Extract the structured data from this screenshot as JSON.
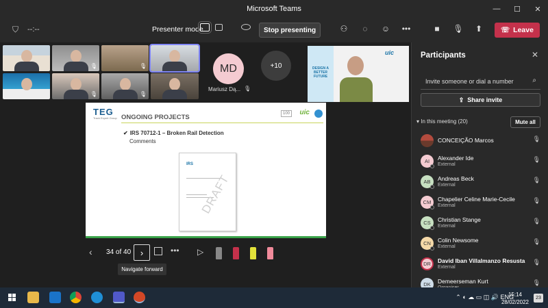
{
  "window": {
    "title": "Microsoft Teams",
    "controls": [
      "—",
      "☐",
      "✕"
    ]
  },
  "toolbar": {
    "timer": "--:--",
    "presenter_mode": "Presenter mode",
    "stop_presenting": "Stop presenting",
    "leave": "Leave"
  },
  "stage": {
    "md_initials": "MD",
    "md_name": "Mariusz Dą...",
    "more_count": "+10"
  },
  "slide": {
    "teg_logo": "TEG",
    "teg_sub": "Track Expert Group",
    "heading": "ONGOING PROJECTS",
    "logo_100": "100",
    "logo_uic": "uic",
    "bullet": "IRS 70712-1 – Broken Rail Detection",
    "sub": "Comments",
    "doc_irs": "IRS",
    "doc_draft": "DRAFT"
  },
  "speaker_banner": "DESIGN A BETTER FUTURE",
  "speaker_logo": "uic",
  "navigation": {
    "counter": "34 of 40",
    "tooltip": "Navigate forward"
  },
  "panel": {
    "title": "Participants",
    "invite_placeholder": "Invite someone or dial a number",
    "share_invite": "Share invite",
    "in_meeting": "In this meeting (20)",
    "mute_all": "Mute all",
    "participants": [
      {
        "initials": "",
        "name": "CONCEIÇÃO Marcos",
        "sub": ""
      },
      {
        "initials": "AI",
        "name": "Alexander Ide",
        "sub": "External"
      },
      {
        "initials": "AB",
        "name": "Andreas Beck",
        "sub": "External"
      },
      {
        "initials": "CM",
        "name": "Chapelier Celine Marie-Cecile",
        "sub": "External"
      },
      {
        "initials": "CS",
        "name": "Christian Stange",
        "sub": "External"
      },
      {
        "initials": "CN",
        "name": "Colin Newsome",
        "sub": "External"
      },
      {
        "initials": "DR",
        "name": "David Iban Villalmanzo Resusta",
        "sub": "External"
      },
      {
        "initials": "DK",
        "name": "Demeerseman Kurt",
        "sub": "Organiser"
      }
    ]
  },
  "taskbar": {
    "tray_lang": "ENG",
    "time": "15:14",
    "date": "28/02/2022",
    "notif_count": "23"
  }
}
